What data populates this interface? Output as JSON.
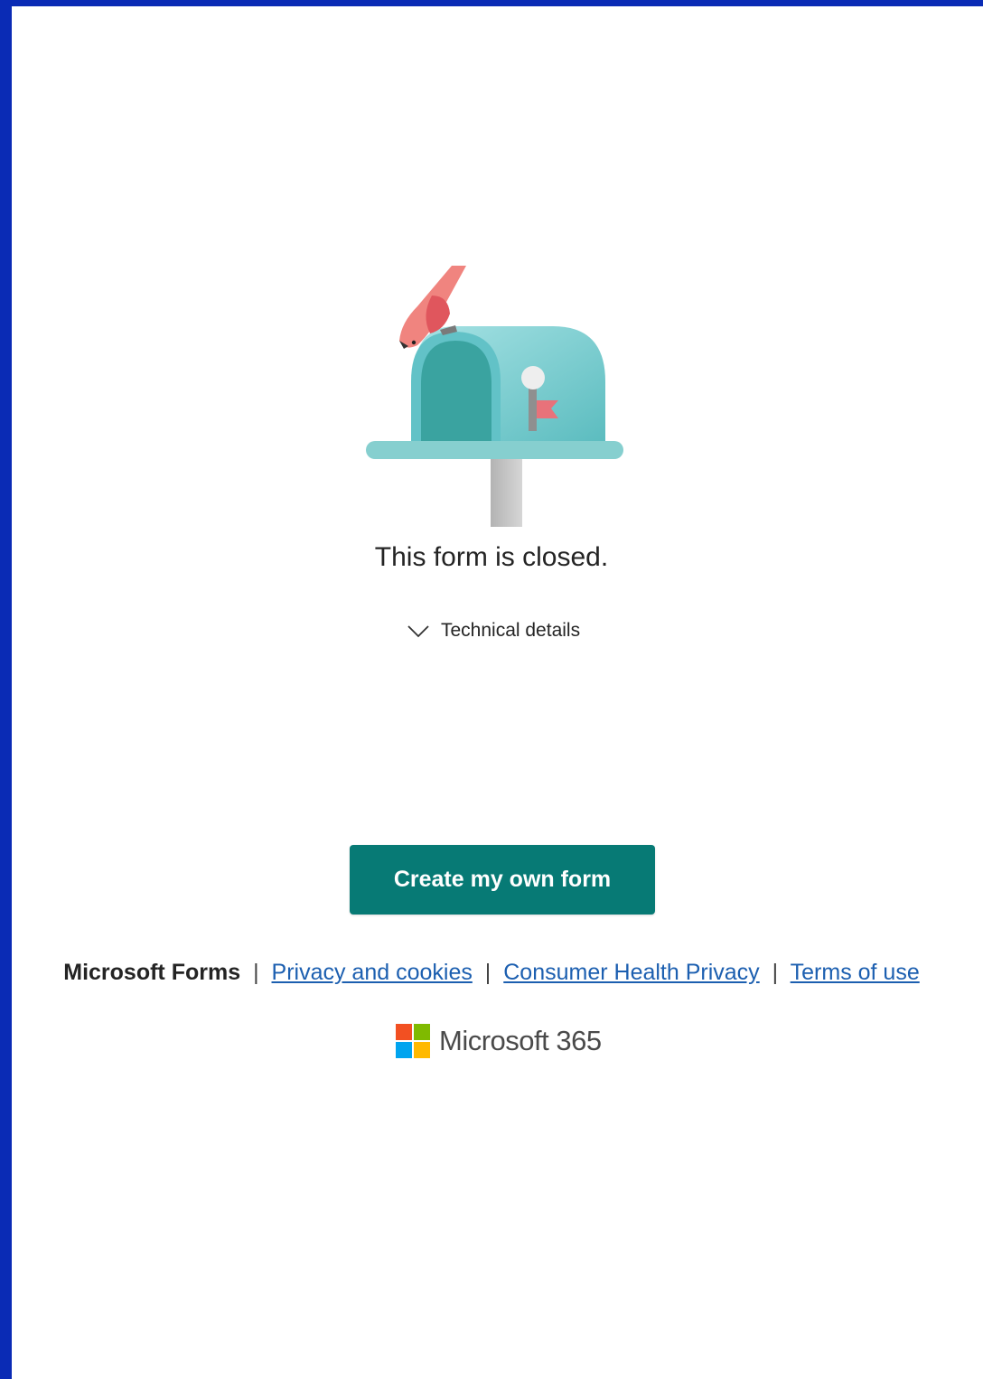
{
  "colors": {
    "page_border": "#0a2bb5",
    "background": "#ffffff",
    "primary_button": "#077a75",
    "link": "#1c5fb0",
    "text": "#242424",
    "ms_logo": [
      "#f25022",
      "#7fba00",
      "#00a4ef",
      "#ffb900"
    ]
  },
  "illustration": {
    "icon": "mailbox-with-bird-illustration"
  },
  "status": {
    "message": "This form is closed."
  },
  "technical_details": {
    "label": "Technical details",
    "icon": "chevron-down-icon"
  },
  "actions": {
    "create_label": "Create my own form"
  },
  "footer": {
    "brand": "Microsoft Forms",
    "separator": "|",
    "links": [
      {
        "label": "Privacy and cookies"
      },
      {
        "label": "Consumer Health Privacy"
      },
      {
        "label": "Terms of use"
      }
    ]
  },
  "product": {
    "name": "Microsoft 365",
    "icon": "microsoft-logo-icon"
  }
}
